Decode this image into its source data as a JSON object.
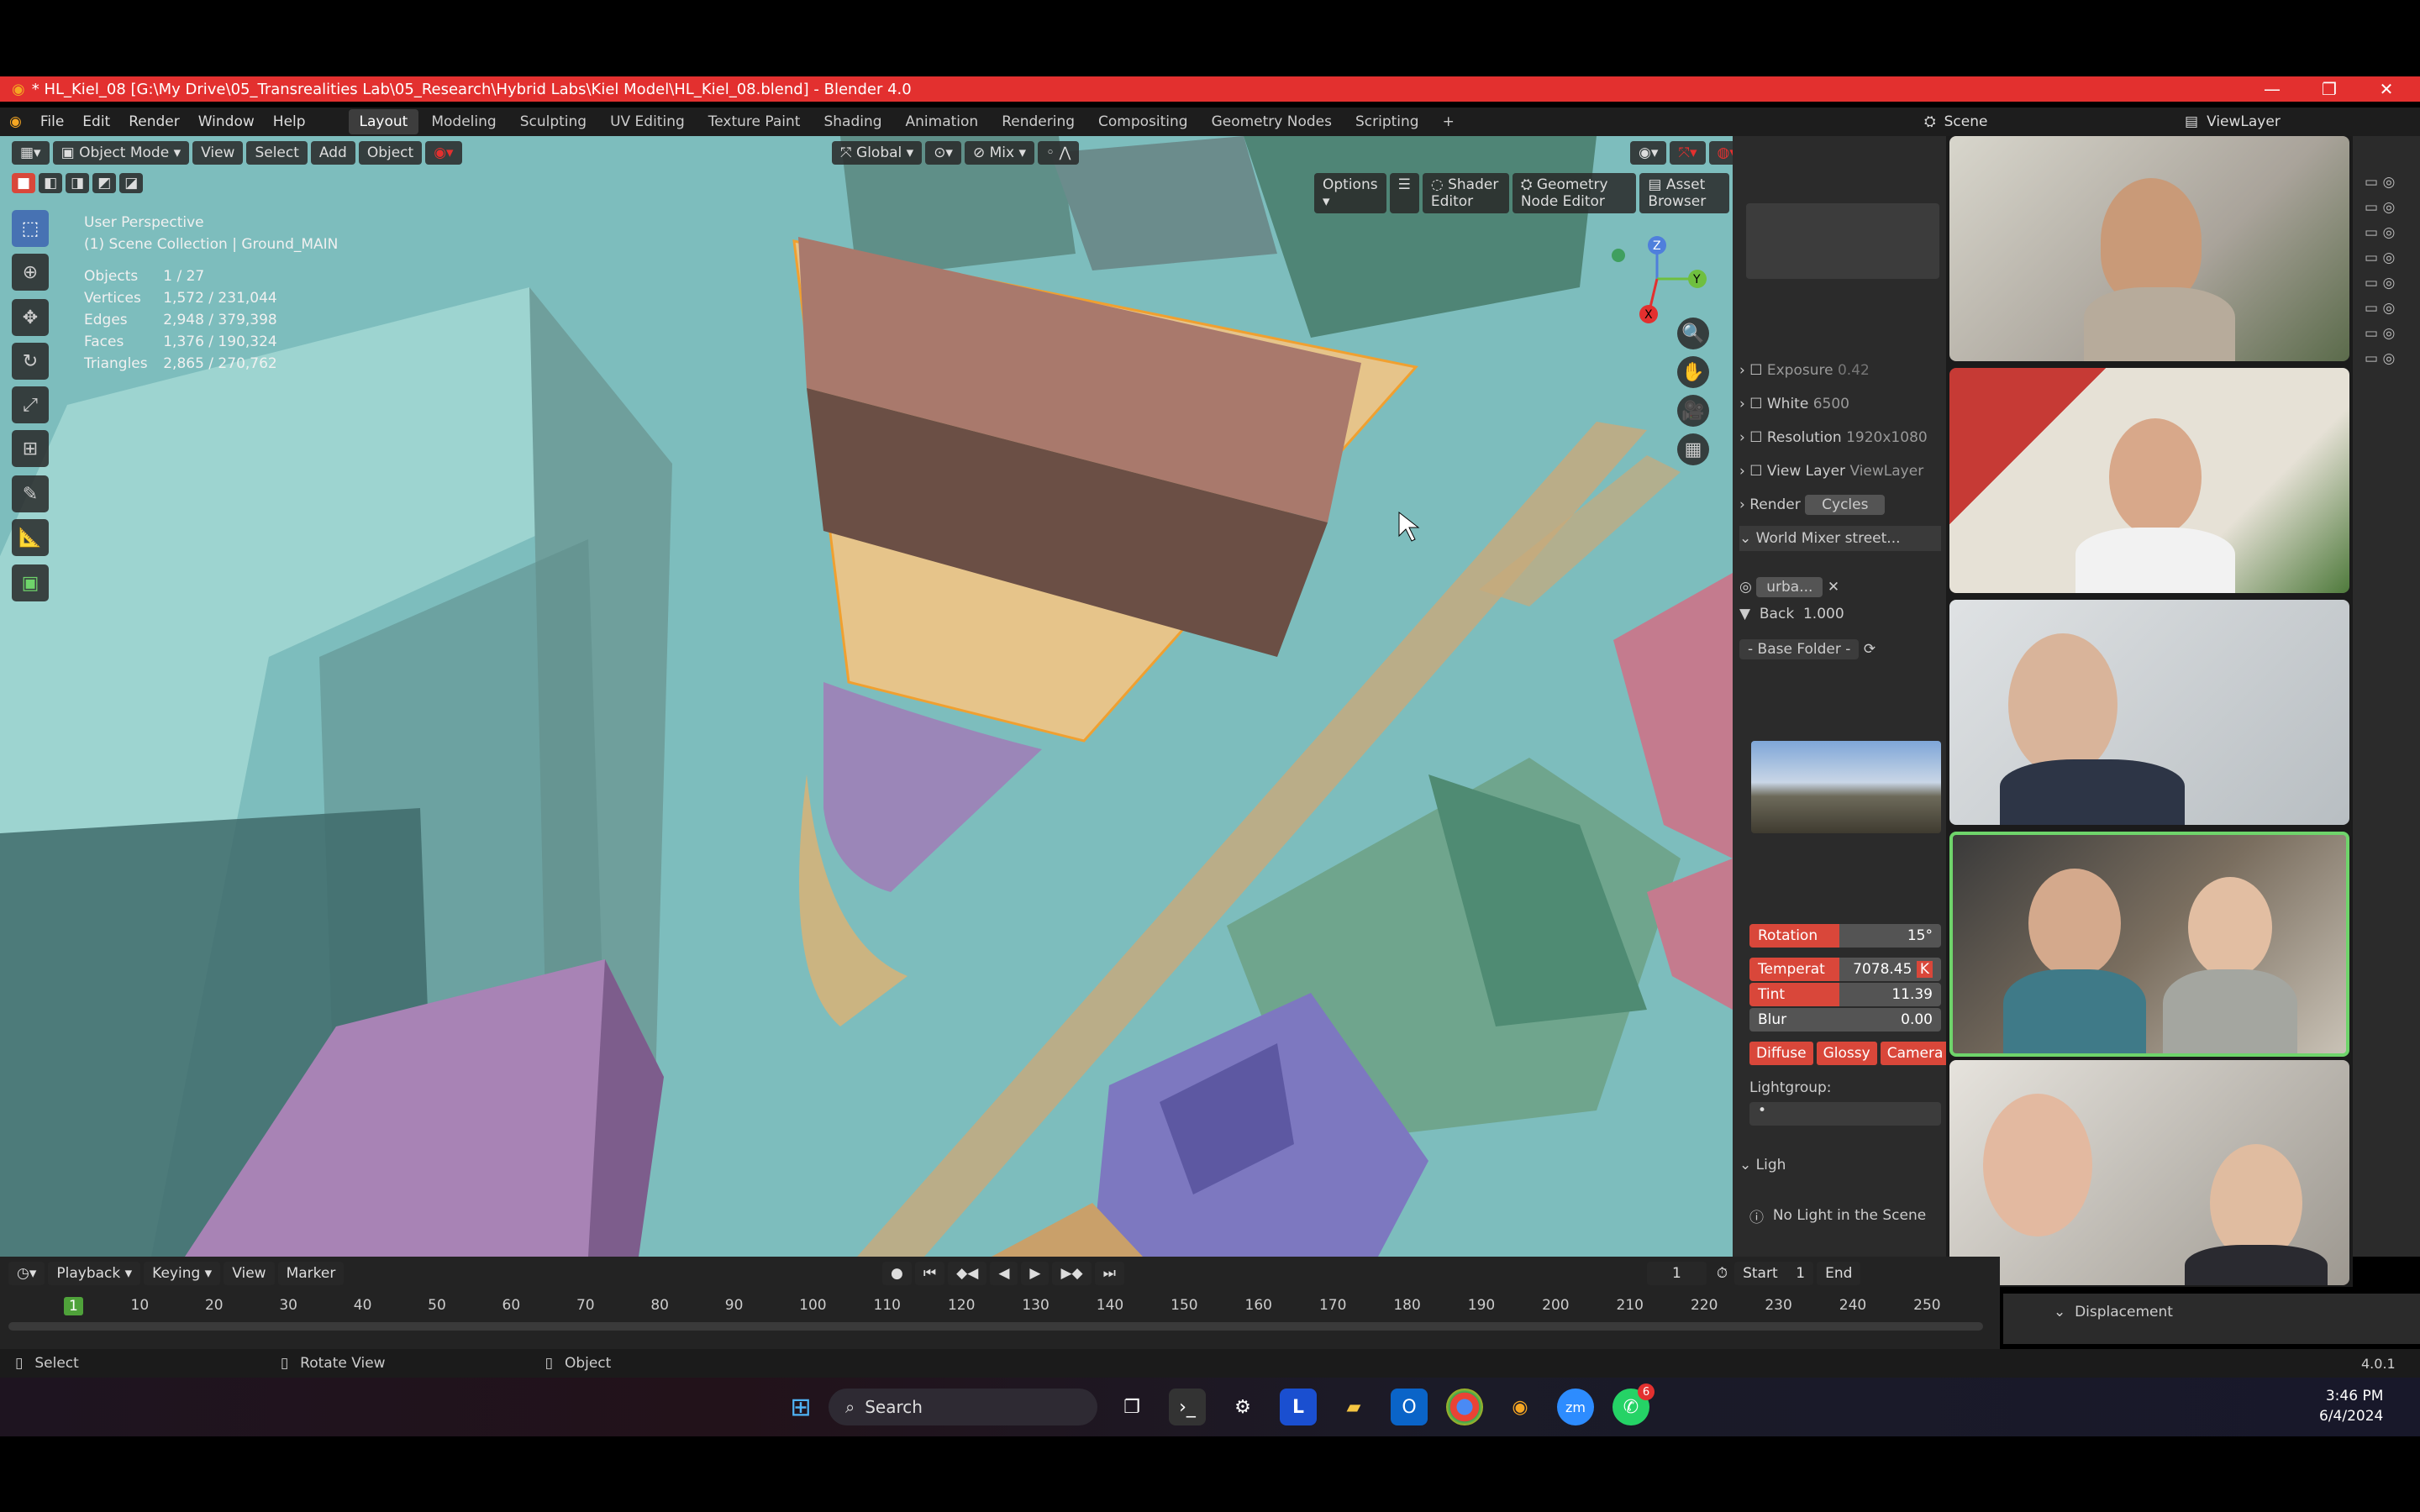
{
  "window": {
    "title": "* HL_Kiel_08 [G:\\My Drive\\05_Transrealities Lab\\05_Research\\Hybrid Labs\\Kiel Model\\HL_Kiel_08.blend] - Blender 4.0"
  },
  "menu": [
    "File",
    "Edit",
    "Render",
    "Window",
    "Help"
  ],
  "workspaces": [
    "Layout",
    "Modeling",
    "Sculpting",
    "UV Editing",
    "Texture Paint",
    "Shading",
    "Animation",
    "Rendering",
    "Compositing",
    "Geometry Nodes",
    "Scripting"
  ],
  "scene": {
    "label": "Scene",
    "view_layer": "ViewLayer"
  },
  "viewport_header": {
    "mode": "Object Mode",
    "items": [
      "View",
      "Select",
      "Add",
      "Object"
    ],
    "transform": "Global",
    "snap": "Mix",
    "options": "Options",
    "editors": [
      "Shader Editor",
      "Geometry Node Editor",
      "Asset Browser"
    ]
  },
  "overlay": {
    "perspective": "User Perspective",
    "collection": "(1) Scene Collection | Ground_MAIN",
    "stats": [
      {
        "label": "Objects",
        "value": "1 / 27"
      },
      {
        "label": "Vertices",
        "value": "1,572 / 231,044"
      },
      {
        "label": "Edges",
        "value": "2,948 / 379,398"
      },
      {
        "label": "Faces",
        "value": "1,376 / 190,324"
      },
      {
        "label": "Triangles",
        "value": "2,865 / 270,762"
      }
    ]
  },
  "properties": {
    "exposure": {
      "label": "Exposure",
      "value": "0.42"
    },
    "white": {
      "label": "White",
      "value": "6500"
    },
    "resolution": {
      "label": "Resolution",
      "value": "1920x1080"
    },
    "view_layer": {
      "label": "View Layer",
      "value": "ViewLayer"
    },
    "render": {
      "label": "Render",
      "value": "Cycles"
    },
    "world": {
      "label": "World Mixer",
      "value": "street..."
    },
    "world_name": "urba...",
    "back": {
      "label": "Back",
      "value": "1.000"
    },
    "base_folder": "- Base Folder -",
    "rotation": {
      "label": "Rotation",
      "value": "15°"
    },
    "temperature": {
      "label": "Temperat",
      "value": "7078.45",
      "unit": "K"
    },
    "tint": {
      "label": "Tint",
      "value": "11.39"
    },
    "blur": {
      "label": "Blur",
      "value": "0.00"
    },
    "buttons": [
      "Diffuse",
      "Glossy",
      "Camera"
    ],
    "lightgroup": "Lightgroup:",
    "lightgroup_value": "•",
    "light_panel": "Ligh",
    "no_light": "No Light in the Scene",
    "displacement": "Displacement",
    "version": "4.0.1"
  },
  "timeline": {
    "menus": [
      "Playback",
      "Keying",
      "View",
      "Marker"
    ],
    "current_frame": "1",
    "start_label": "Start",
    "start": "1",
    "end_label": "End",
    "ticks": [
      "1",
      "10",
      "20",
      "30",
      "40",
      "50",
      "60",
      "70",
      "80",
      "90",
      "100",
      "110",
      "120",
      "130",
      "140",
      "150",
      "160",
      "170",
      "180",
      "190",
      "200",
      "210",
      "220",
      "230",
      "240",
      "250"
    ]
  },
  "statusbar": {
    "items": [
      "Select",
      "Rotate View",
      "Object"
    ]
  },
  "taskbar": {
    "search": "Search",
    "time": "3:46 PM",
    "date": "6/4/2024",
    "whatsapp_badge": "6"
  },
  "colors": {
    "title_red": "#e3302f",
    "viewport_bg": "#7dbdbd",
    "selection_orange": "#f0a030",
    "accent_blue": "#4772b3",
    "speaking_green": "#6fd46b"
  }
}
